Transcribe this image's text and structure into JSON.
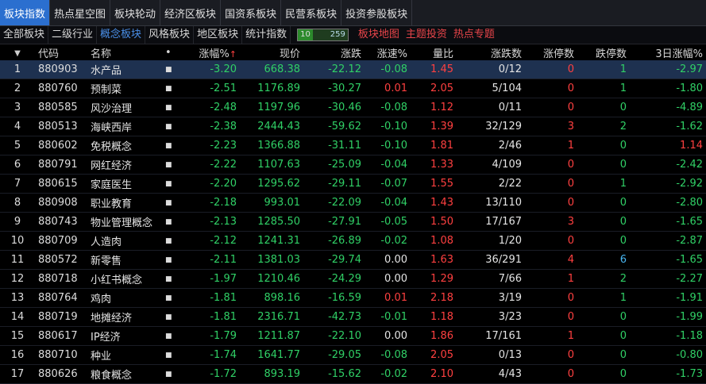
{
  "tabs_top": [
    "板块指数",
    "热点星空图",
    "板块轮动",
    "经济区板块",
    "国资系板块",
    "民营系板块",
    "投资参股板块"
  ],
  "tabs_top_active": 0,
  "tabs_sub": [
    "全部板块",
    "二级行业",
    "概念板块",
    "风格板块",
    "地区板块",
    "统计指数"
  ],
  "tabs_sub_active": 2,
  "counter": {
    "left": "10",
    "right": "259"
  },
  "tabs_sub_links": [
    "板块地图",
    "主题投资",
    "热点专题"
  ],
  "columns": [
    "代码",
    "名称",
    "•",
    "涨幅%",
    "现价",
    "涨跌",
    "涨速%",
    "量比",
    "涨跌数",
    "涨停数",
    "跌停数",
    "3日涨幅%"
  ],
  "header_arrow": "▼",
  "sort_arrow": "↑",
  "colors": {
    "up": "#ff4040",
    "down": "#30d066",
    "neutral": "#e4e4e4",
    "blue": "#49b7f2",
    "accent": "#2b6fcf"
  },
  "rows": [
    {
      "idx": "1",
      "code": "880903",
      "name": "水产品",
      "dot": "■",
      "pct": "-3.20",
      "price": "668.38",
      "chg": "-22.12",
      "spd": "-0.08",
      "vr": "1.45",
      "ud": "0/12",
      "lu": "0",
      "ld": "1",
      "d3": "-2.97"
    },
    {
      "idx": "2",
      "code": "880760",
      "name": "预制菜",
      "dot": "■",
      "pct": "-2.51",
      "price": "1176.89",
      "chg": "-30.27",
      "spd": "0.01",
      "vr": "2.05",
      "ud": "5/104",
      "lu": "0",
      "ld": "1",
      "d3": "-1.80"
    },
    {
      "idx": "3",
      "code": "880585",
      "name": "风沙治理",
      "dot": "■",
      "pct": "-2.48",
      "price": "1197.96",
      "chg": "-30.46",
      "spd": "-0.08",
      "vr": "1.12",
      "ud": "0/11",
      "lu": "0",
      "ld": "0",
      "d3": "-4.89"
    },
    {
      "idx": "4",
      "code": "880513",
      "name": "海峡西岸",
      "dot": "■",
      "pct": "-2.38",
      "price": "2444.43",
      "chg": "-59.62",
      "spd": "-0.10",
      "vr": "1.39",
      "ud": "32/129",
      "lu": "3",
      "ld": "2",
      "d3": "-1.62"
    },
    {
      "idx": "5",
      "code": "880602",
      "name": "免税概念",
      "dot": "■",
      "pct": "-2.23",
      "price": "1366.88",
      "chg": "-31.11",
      "spd": "-0.10",
      "vr": "1.81",
      "ud": "2/46",
      "lu": "1",
      "ld": "0",
      "d3": "1.14"
    },
    {
      "idx": "6",
      "code": "880791",
      "name": "网红经济",
      "dot": "■",
      "pct": "-2.22",
      "price": "1107.63",
      "chg": "-25.09",
      "spd": "-0.04",
      "vr": "1.33",
      "ud": "4/109",
      "lu": "0",
      "ld": "0",
      "d3": "-2.42"
    },
    {
      "idx": "7",
      "code": "880615",
      "name": "家庭医生",
      "dot": "■",
      "pct": "-2.20",
      "price": "1295.62",
      "chg": "-29.11",
      "spd": "-0.07",
      "vr": "1.55",
      "ud": "2/22",
      "lu": "0",
      "ld": "1",
      "d3": "-2.92"
    },
    {
      "idx": "8",
      "code": "880908",
      "name": "职业教育",
      "dot": "■",
      "pct": "-2.18",
      "price": "993.01",
      "chg": "-22.09",
      "spd": "-0.04",
      "vr": "1.43",
      "ud": "13/110",
      "lu": "0",
      "ld": "0",
      "d3": "-2.80"
    },
    {
      "idx": "9",
      "code": "880743",
      "name": "物业管理概念",
      "dot": "■",
      "pct": "-2.13",
      "price": "1285.50",
      "chg": "-27.91",
      "spd": "-0.05",
      "vr": "1.50",
      "ud": "17/167",
      "lu": "3",
      "ld": "0",
      "d3": "-1.65"
    },
    {
      "idx": "10",
      "code": "880709",
      "name": "人造肉",
      "dot": "■",
      "pct": "-2.12",
      "price": "1241.31",
      "chg": "-26.89",
      "spd": "-0.02",
      "vr": "1.08",
      "ud": "1/20",
      "lu": "0",
      "ld": "0",
      "d3": "-2.87"
    },
    {
      "idx": "11",
      "code": "880572",
      "name": "新零售",
      "dot": "■",
      "pct": "-2.11",
      "price": "1381.03",
      "chg": "-29.74",
      "spd": "0.00",
      "vr": "1.63",
      "ud": "36/291",
      "lu": "4",
      "ld": "6",
      "d3": "-1.65"
    },
    {
      "idx": "12",
      "code": "880718",
      "name": "小红书概念",
      "dot": "■",
      "pct": "-1.97",
      "price": "1210.46",
      "chg": "-24.29",
      "spd": "0.00",
      "vr": "1.29",
      "ud": "7/66",
      "lu": "1",
      "ld": "2",
      "d3": "-2.27"
    },
    {
      "idx": "13",
      "code": "880764",
      "name": "鸡肉",
      "dot": "■",
      "pct": "-1.81",
      "price": "898.16",
      "chg": "-16.59",
      "spd": "0.01",
      "vr": "2.18",
      "ud": "3/19",
      "lu": "0",
      "ld": "1",
      "d3": "-1.91"
    },
    {
      "idx": "14",
      "code": "880719",
      "name": "地摊经济",
      "dot": "■",
      "pct": "-1.81",
      "price": "2316.71",
      "chg": "-42.73",
      "spd": "-0.01",
      "vr": "1.18",
      "ud": "3/23",
      "lu": "0",
      "ld": "0",
      "d3": "-1.99"
    },
    {
      "idx": "15",
      "code": "880617",
      "name": "IP经济",
      "dot": "■",
      "pct": "-1.79",
      "price": "1211.87",
      "chg": "-22.10",
      "spd": "0.00",
      "vr": "1.86",
      "ud": "17/161",
      "lu": "1",
      "ld": "0",
      "d3": "-1.18"
    },
    {
      "idx": "16",
      "code": "880710",
      "name": "种业",
      "dot": "■",
      "pct": "-1.74",
      "price": "1641.77",
      "chg": "-29.05",
      "spd": "-0.08",
      "vr": "2.05",
      "ud": "0/13",
      "lu": "0",
      "ld": "0",
      "d3": "-0.80"
    },
    {
      "idx": "17",
      "code": "880626",
      "name": "粮食概念",
      "dot": "■",
      "pct": "-1.72",
      "price": "893.19",
      "chg": "-15.62",
      "spd": "-0.02",
      "vr": "2.10",
      "ud": "4/43",
      "lu": "0",
      "ld": "0",
      "d3": "-1.73"
    }
  ]
}
